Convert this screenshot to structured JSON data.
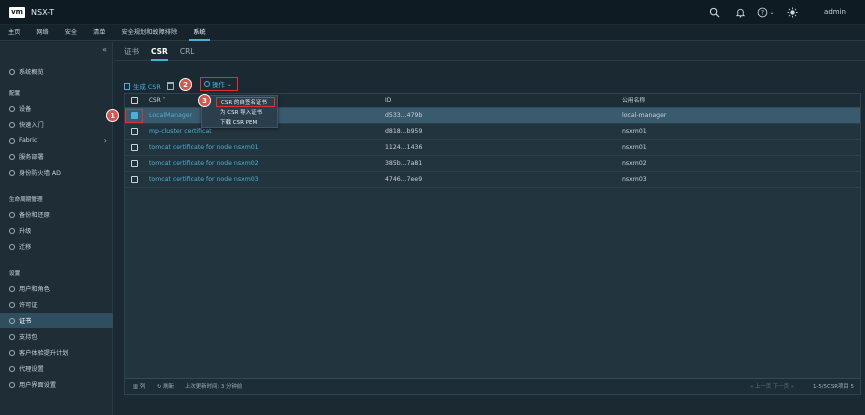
{
  "header": {
    "logo": "vm",
    "title": "NSX-T",
    "user": "admin",
    "icons": [
      "search-icon",
      "bell-icon",
      "help-icon",
      "theme-icon"
    ],
    "help_caret": "⌄"
  },
  "nav": [
    "主页",
    "网络",
    "安全",
    "清单",
    "安全规划和故障排除",
    "系统"
  ],
  "sidebar": {
    "collapse": "«",
    "sections": [
      {
        "items": [
          "系统概览"
        ]
      },
      {
        "header": "配置",
        "items": [
          "设备",
          "快速入门",
          "Fabric",
          "服务部署",
          "身份防火墙 AD"
        ]
      },
      {
        "header": "生命周期管理",
        "items": [
          "备份和还原",
          "升级",
          "迁移"
        ]
      },
      {
        "header": "设置",
        "items": [
          "用户和角色",
          "许可证",
          "证书",
          "支持包",
          "客户体验提升计划",
          "代理设置",
          "用户界面设置"
        ]
      }
    ],
    "fabric_chevron": "›"
  },
  "tabs": [
    "证书",
    "CSR",
    "CRL"
  ],
  "toolbar": {
    "generate": "生成 CSR",
    "actions": "操作",
    "actions_caret": "⌄"
  },
  "menu": [
    "CSR 的自签名证书",
    "为 CSR 导入证书",
    "下载 CSR PEM"
  ],
  "table": {
    "columns": [
      "CSR",
      "ID",
      "公用名称"
    ],
    "sort_indicator": "˅",
    "rows": [
      {
        "name": "LocalManager",
        "id": "d533...479b",
        "cn": "local-manager",
        "selected": true
      },
      {
        "name": "mp-cluster certificat",
        "id": "d818...b959",
        "cn": "nsxm01",
        "selected": false
      },
      {
        "name": "tomcat certificate for node nsxm01",
        "id": "1124...1436",
        "cn": "nsxm01",
        "selected": false
      },
      {
        "name": "tomcat certificate for node nsxm02",
        "id": "385b...7a81",
        "cn": "nsxm02",
        "selected": false
      },
      {
        "name": "tomcat certificate for node nsxm03",
        "id": "4746...7ee9",
        "cn": "nsxm03",
        "selected": false
      }
    ],
    "footer": {
      "columns": "列",
      "refresh": "刷新",
      "updated": "上次更新时间: 3 分钟前",
      "pager": "« 上一页   下一页 »",
      "count": "1-5/5CSR项目 5"
    }
  },
  "badges": [
    "1",
    "2",
    "3"
  ],
  "colors": {
    "accent": "#49afd9",
    "highlight": "#e03030",
    "selected_row": "#3a5a6d"
  }
}
